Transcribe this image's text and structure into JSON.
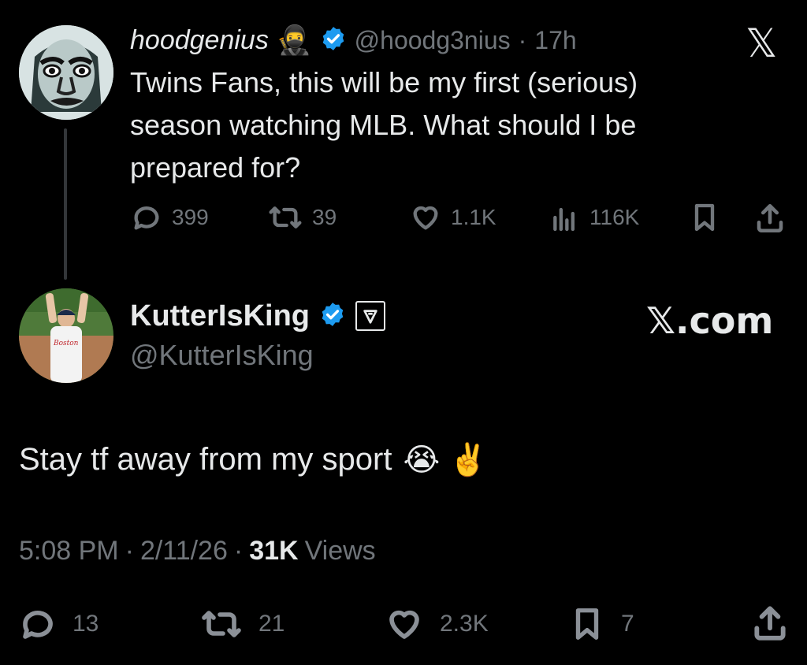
{
  "brand_colors": {
    "background": "#000000",
    "text": "#e7e9ea",
    "muted": "#71767b",
    "verified": "#1d9bf0"
  },
  "original_tweet": {
    "display_name": "hoodgenius",
    "name_emoji": "🥷",
    "handle": "@hoodg3nius",
    "separator": "·",
    "time": "17h",
    "text": "Twins Fans, this will be my first (serious) season watching MLB. What should I be prepared for?",
    "actions": {
      "reply_icon": "reply-icon",
      "replies": "399",
      "retweet_icon": "retweet-icon",
      "retweets": "39",
      "like_icon": "heart-icon",
      "likes": "1.1K",
      "views_icon": "views-icon",
      "views": "116K",
      "bookmark_icon": "bookmark-icon",
      "share_icon": "share-icon"
    },
    "platform_logo": "𝕏"
  },
  "reply_tweet": {
    "display_name": "KutterIsKing",
    "handle": "@KutterIsKing",
    "text": "Stay tf away from my sport",
    "emojis": "😭 ✌️",
    "timestamp_time": "5:08 PM",
    "timestamp_sep1": "·",
    "timestamp_date": "2/11/26",
    "timestamp_sep2": "·",
    "views_count": "31K",
    "views_label": "Views",
    "actions": {
      "replies": "13",
      "retweets": "21",
      "likes": "2.3K",
      "bookmarks": "7"
    },
    "watermark": "𝕏.com"
  }
}
